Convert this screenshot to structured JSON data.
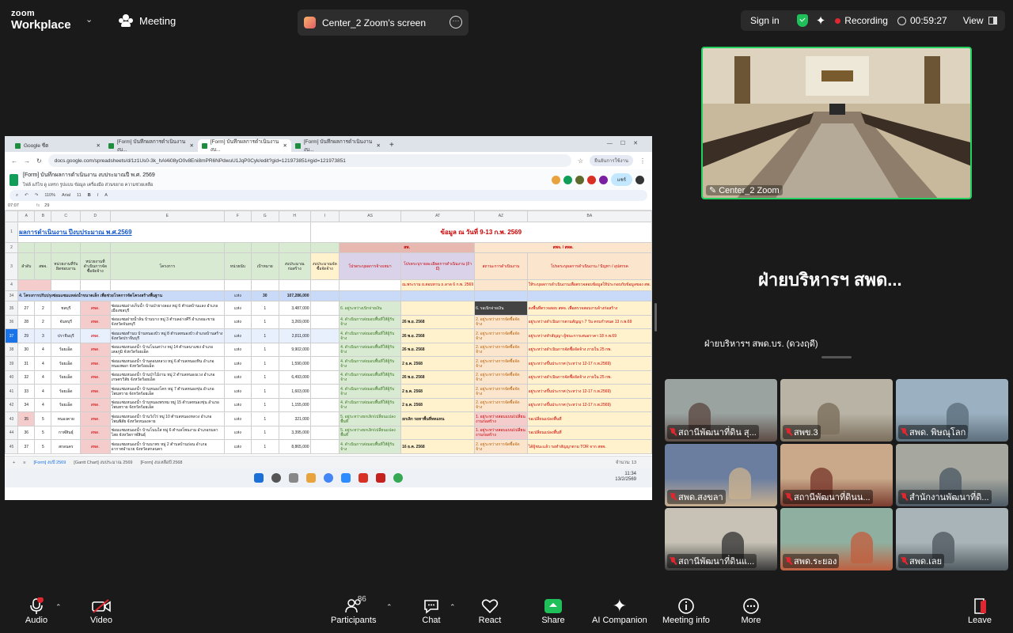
{
  "app": {
    "logo_line1": "zoom",
    "logo_line2": "Workplace"
  },
  "topbar": {
    "meeting_label": "Meeting",
    "screen_tab_label": "Center_2 Zoom's screen",
    "signin_label": "Sign in",
    "recording_label": "Recording",
    "timer": "00:59:27",
    "view_label": "View"
  },
  "browser": {
    "tabs": [
      {
        "label": "Google ชีต"
      },
      {
        "label": "[Form] บันทึกผลการดำเนินงาน งบ..."
      },
      {
        "label": "[Form] บันทึกผลการดำเนินงาน งบ..."
      },
      {
        "label": "[Form] บันทึกผลการดำเนินงาน งบ..."
      }
    ],
    "url": "docs.google.com/spreadsheets/d/1z1Us0-3k_hAl4i08yO0v8Eni8mPR6NPdwuU1JqP0Cyk/edit?gid=121973851#gid=121973851",
    "account_label": "ยืนยันการใช้งาน"
  },
  "sheets": {
    "doc_title": "[Form] บันทึกผลการดำเนินงาน งบประมาณปี พ.ศ. 2569",
    "menus": "ไฟล์  แก้ไข  ดู  แทรก  รูปแบบ  ข้อมูล  เครื่องมือ  ส่วนขยาย  ความช่วยเหลือ",
    "share_label": "แชร์",
    "toolbar_zoom": "110%",
    "toolbar_font": "Arial",
    "toolbar_size": "11",
    "cell_ref": "07:07",
    "formula": "29",
    "left_header_title": "ผลการดำเนินงาน ปีงบประมาณ พ.ศ.2569",
    "right_header_title": "ข้อมูล ณ วันที่ 9-13 ก.พ. 2569",
    "col_letters": [
      "",
      "A",
      "B",
      "C",
      "D",
      "E",
      "F",
      "G",
      "H",
      "I",
      "AS",
      "AT",
      "AZ",
      "BA"
    ],
    "group_headers": {
      "sp": "สพ.",
      "spsp": "สพจ. / สพด."
    },
    "headers": {
      "no": "ลำดับ",
      "sp": "สพจ.",
      "agency": "หน่วยงานที่รับผิดชอบงาน",
      "type": "หน่วยงานที่ดำเนินการจัดซื้อจัดจ้าง",
      "project": "โครงการ",
      "unit": "หน่วยนับ",
      "target": "เป้าหมาย",
      "budget": "งบประมาณก่อสร้าง",
      "procure": "งบประมาณจัดซื้อจัดจ้าง",
      "as": "โปรดระบุผลการจ้างเหมา",
      "at": "โปรดระบุรายละเอียดการดำเนินงาน (ถ้ามี)",
      "az": "สถานะการดำเนินงาน",
      "ba": "โปรดระบุผลการดำเนินงาน / ปัญหา / อุปสรรค"
    },
    "note_row": {
      "at": "ณ.พระราม ย.สอบทาน ถ.ลาด 6 ก.พ. 2569",
      "ba": "ให้ระบุผลการดำเนินงานเพื่อตรวจสอบข้อมูลให้ประกอบกับข้อมูลของ สพ."
    },
    "summary_row": {
      "label": "4. โครงการปรับปรุงซ่อมแซมแหล่งน้ำขนาดเล็ก เพื่อช่วยโรคการจัดโครงสร้างพื้นฐาน",
      "unit": "แห่ง",
      "target": "30",
      "budget": "107,286,000"
    },
    "rows": [
      {
        "r": "35",
        "no": "27",
        "sp": "2",
        "agency": "ชลบุรี",
        "type": "สพด.",
        "project": "ซ่อมแซมอ่างเก็บน้ำ บ้านป่ายางลอง หมู่ 6 ตำบลบ้านแลง อำเภอเมืองชลบุรี",
        "unit": "แห่ง",
        "target": "1",
        "budget": "3,487,000",
        "as": "6. อยู่ระหว่างเบิกจ่ายเงิน",
        "at": "",
        "az": "6. รอเบิกจ่ายเงิน",
        "ba": "ลงพื้นที่ตรวจสอบ สพจ. เพื่อตรวจสอบงานจ้างก่อสร้าง"
      },
      {
        "r": "36",
        "no": "28",
        "sp": "2",
        "agency": "จันทบุรี",
        "type": "สพด.",
        "project": "ซ่อมแซมฝายน้ำล้น บ้านบาง หมู่ 3 ตำบลอ่างคีรี อำเภอมะขาม จังหวัดจันทบุรี",
        "unit": "แห่ง",
        "target": "1",
        "budget": "3,269,000",
        "as": "4. ดำเนินการส่งมอบพื้นที่ให้ผู้รับจ้าง",
        "at": "26 พ.ย. 2568",
        "az": "2. อยู่ระหว่างการจัดซื้อจัดจ้าง",
        "ba": "อยู่ระหว่างดำเนินการตามสัญญา 7 วัน ครบกำหนด 13 ก.พ.69"
      },
      {
        "r": "37",
        "no": "29",
        "sp": "3",
        "agency": "ปราจีนบุรี",
        "type": "สพด.",
        "project": "ซ่อมแซมทำนบ บ้านหนองบัว หมู่ 8 ตำบลหนองบัว อำเภอบ้านสร้าง จังหวัดปราจีนบุรี",
        "unit": "แห่ง",
        "target": "1",
        "budget": "2,811,000",
        "as": "4. ดำเนินการส่งมอบพื้นที่ให้ผู้รับจ้าง",
        "at": "26 พ.ย. 2568",
        "az": "2. อยู่ระหว่างการจัดซื้อจัดจ้าง",
        "ba": "อยู่ระหว่างทำสัญญา ผู้ชนะการเสนอราคา 18 ก.พ.69"
      },
      {
        "r": "38",
        "no": "30",
        "sp": "4",
        "agency": "ร้อยเอ็ด",
        "type": "สพด.",
        "project": "ซ่อมแซมหนองน้ำ บ้านโนนสว่าง หมู่ 14 ตำบลนาแซง อำเภอเสลภูมิ จังหวัดร้อยเอ็ด",
        "unit": "แห่ง",
        "target": "1",
        "budget": "9,902,000",
        "as": "4. ดำเนินการส่งมอบพื้นที่ให้ผู้รับจ้าง",
        "at": "26 พ.ย. 2568",
        "az": "2. อยู่ระหว่างการจัดซื้อจัดจ้าง",
        "ba": "อยู่ระหว่างดำเนินการจัดซื้อจัดจ้าง ภายใน 25 กพ."
      },
      {
        "r": "39",
        "no": "31",
        "sp": "4",
        "agency": "ร้อยเอ็ด",
        "type": "สพด.",
        "project": "ซ่อมแซมหนองน้ำ บ้านดอนหลวง หมู่ 6 ตำบลหนองหิน อำเภอหนองพอก จังหวัดร้อยเอ็ด",
        "unit": "แห่ง",
        "target": "1",
        "budget": "1,590,000",
        "as": "4. ดำเนินการส่งมอบพื้นที่ให้ผู้รับจ้าง",
        "at": "2 ธ.ค. 2568",
        "az": "2. อยู่ระหว่างการจัดซื้อจัดจ้าง",
        "ba": "อยู่ระหว่างขึ้นประกาศ (ระหว่าง 12-17 ก.พ.2569)"
      },
      {
        "r": "40",
        "no": "32",
        "sp": "4",
        "agency": "ร้อยเอ็ด",
        "type": "สพด.",
        "project": "ซ่อมแซมหนองน้ำ บ้านป่าไม้งาม หมู่ 2 ตำบลหนองแวง อำเภอเกษตรวิสัย จังหวัดร้อยเอ็ด",
        "unit": "แห่ง",
        "target": "1",
        "budget": "6,493,000",
        "as": "4. ดำเนินการส่งมอบพื้นที่ให้ผู้รับจ้าง",
        "at": "26 พ.ย. 2568",
        "az": "2. อยู่ระหว่างการจัดซื้อจัดจ้าง",
        "ba": "อยู่ระหว่างดำเนินการจัดซื้อจัดจ้าง ภายใน 25 กพ."
      },
      {
        "r": "41",
        "no": "33",
        "sp": "4",
        "agency": "ร้อยเอ็ด",
        "type": "สพด.",
        "project": "ซ่อมแซมหนองน้ำ บ้านหนองโคก หมู่ 7 ตำบลหนองขุ่น อำเภอโพนทราย จังหวัดร้อยเอ็ด",
        "unit": "แห่ง",
        "target": "1",
        "budget": "1,603,000",
        "as": "4. ดำเนินการส่งมอบพื้นที่ให้ผู้รับจ้าง",
        "at": "2 ธ.ค. 2568",
        "az": "2. อยู่ระหว่างการจัดซื้อจัดจ้าง",
        "ba": "อยู่ระหว่างขึ้นประกาศ (ระหว่าง 12-17 ก.พ.2569)"
      },
      {
        "r": "42",
        "no": "34",
        "sp": "4",
        "agency": "ร้อยเอ็ด",
        "type": "สพด.",
        "project": "ซ่อมแซมหนองน้ำ บ้านหนองพรหม หมู่ 15 ตำบลหนองขุ่น อำเภอโพนทราย จังหวัดร้อยเอ็ด",
        "unit": "แห่ง",
        "target": "1",
        "budget": "1,155,000",
        "as": "4. ดำเนินการส่งมอบพื้นที่ให้ผู้รับจ้าง",
        "at": "2 ธ.ค. 2568",
        "az": "2. อยู่ระหว่างการจัดซื้อจัดจ้าง",
        "ba": "อยู่ระหว่างขึ้นประกาศ (ระหว่าง 12-17 ก.พ.2569)"
      },
      {
        "r": "43",
        "no": "35",
        "sp": "5",
        "agency": "หนองคาย",
        "type": "สพด.",
        "project": "ซ่อมแซมหนองน้ำ บ้านวังไร่ หมู่ 10 ตำบลหนองหลวง อำเภอโพนพิสัย จังหวัดหนองคาย",
        "unit": "แห่ง",
        "target": "1",
        "budget": "321,000",
        "as": "5. อยู่ระหว่างยกเลิก/เปลี่ยนแปลงพื้นที่",
        "at": "ยกเลิก รอหาพื้นที่ทดแทน",
        "az": "1. อยู่ระหว่างสอบแบบ/เปลี่ยนงานก่อสร้าง",
        "ba": "รอเปลี่ยนแปลงพื้นที่"
      },
      {
        "r": "44",
        "no": "36",
        "sp": "5",
        "agency": "กาฬสินธุ์",
        "type": "สพด.",
        "project": "ซ่อมแซมหนองน้ำ บ้านโนนใส หมู่ 6 ตำบลโพนงาม อำเภอกมลาไสย จังหวัดกาฬสินธุ์",
        "unit": "แห่ง",
        "target": "1",
        "budget": "3,395,000",
        "as": "5. อยู่ระหว่างยกเลิก/เปลี่ยนแปลงพื้นที่",
        "at": "",
        "az": "1. อยู่ระหว่างสอบแบบ/เปลี่ยนงานก่อสร้าง",
        "ba": "รอเปลี่ยนแปลงพื้นที่"
      },
      {
        "r": "45",
        "no": "37",
        "sp": "5",
        "agency": "สกลนคร",
        "type": "สพด.",
        "project": "ซ่อมแซมหนองน้ำ บ้านนาพร หมู่ 2 ตำบลบ้านถ่อน อำเภออากาศอำนวย จังหวัดสกลนคร",
        "unit": "แห่ง",
        "target": "1",
        "budget": "8,865,000",
        "as": "4. ดำเนินการส่งมอบพื้นที่ให้ผู้รับจ้าง",
        "at": "16 ธ.ค. 2568",
        "az": "2. อยู่ระหว่างการจัดซื้อจัดจ้าง",
        "ba": "ได้ผู้ชนะแล้ว รอทำสัญญาตาม TOR จาก สพจ."
      }
    ],
    "sheet_tabs": [
      "[Form] งบปี 2569",
      "[Gantt Chart] งบประมาณ 2569",
      "[Form] งบเหลือปี 2568"
    ],
    "sheet_count": "จำนวน: 13",
    "taskbar_time": "11:34",
    "taskbar_date": "13/2/2569",
    "taskbar_lang": "ไทย"
  },
  "video": {
    "main_tile_name": "Center_2 Zoom",
    "active_speaker_big": "ฝ่ายบริหารฯ สพด...",
    "active_speaker_full": "ฝ่ายบริหารฯ สพด.บร. (ดวงฤดี)",
    "tiles": [
      {
        "name": "สถานีพัฒนาที่ดิน สุ..."
      },
      {
        "name": "สพข.3"
      },
      {
        "name": "สพด. พิษณุโลก"
      },
      {
        "name": "สพด.สงขลา"
      },
      {
        "name": "สถานีพัฒนาที่ดินน..."
      },
      {
        "name": "สำนักงานพัฒนาที่ดิ..."
      },
      {
        "name": "สถานีพัฒนาที่ดินแ..."
      },
      {
        "name": "สพด.ระยอง"
      },
      {
        "name": "สพด.เลย"
      }
    ]
  },
  "bottombar": {
    "audio": "Audio",
    "video": "Video",
    "participants": "Participants",
    "participants_count": "86",
    "chat": "Chat",
    "react": "React",
    "share": "Share",
    "ai": "AI Companion",
    "info": "Meeting info",
    "more": "More",
    "leave": "Leave"
  },
  "colors": {
    "accent_green": "#23d160",
    "record_red": "#e0262f",
    "sheet_pink": "#f4cccc",
    "sheet_yellow": "#fff2cc",
    "sheet_green": "#d9ead3"
  }
}
